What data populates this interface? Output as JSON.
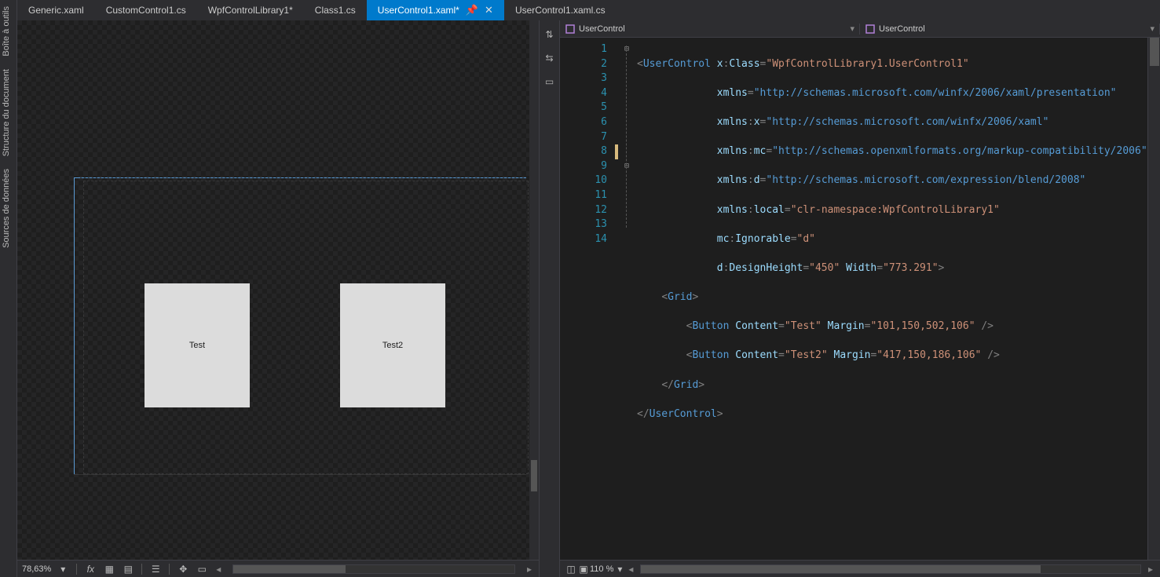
{
  "sidebars": {
    "toolbox": "Boîte à outils",
    "document_structure": "Structure du document",
    "data_sources": "Sources de données"
  },
  "tabs": [
    {
      "label": "Generic.xaml"
    },
    {
      "label": "CustomControl1.cs"
    },
    {
      "label": "WpfControlLibrary1*"
    },
    {
      "label": "Class1.cs"
    },
    {
      "label": "UserControl1.xaml*",
      "active": true,
      "closeable": true
    },
    {
      "label": "UserControl1.xaml.cs"
    }
  ],
  "designer": {
    "button1_text": "Test",
    "button2_text": "Test2",
    "zoom": "78,63%"
  },
  "code_nav": {
    "left": "UserControl",
    "right": "UserControl"
  },
  "editor": {
    "lines": [
      "1",
      "2",
      "3",
      "4",
      "5",
      "6",
      "7",
      "8",
      "9",
      "10",
      "11",
      "12",
      "13",
      "14"
    ],
    "zoom": "110 %"
  },
  "xaml": {
    "userControlOpen": "UserControl",
    "xClass_attr": "x",
    "xClass_name": "Class",
    "xClass_val": "WpfControlLibrary1.UserControl1",
    "xmlns": "xmlns",
    "xmlns_val": "http://schemas.microsoft.com/winfx/2006/xaml/presentation",
    "xmlns_x_name": "x",
    "xmlns_x_val": "http://schemas.microsoft.com/winfx/2006/xaml",
    "xmlns_mc_name": "mc",
    "xmlns_mc_val": "http://schemas.openxmlformats.org/markup-compatibility/2006",
    "xmlns_d_name": "d",
    "xmlns_d_val": "http://schemas.microsoft.com/expression/blend/2008",
    "xmlns_local_name": "local",
    "xmlns_local_val": "clr-namespace:WpfControlLibrary1",
    "mc": "mc",
    "ignorable": "Ignorable",
    "ignorable_val": "d",
    "d": "d",
    "designHeight": "DesignHeight",
    "designHeight_val": "450",
    "width": "Width",
    "width_val": "773.291",
    "grid": "Grid",
    "button": "Button",
    "content": "Content",
    "margin": "Margin",
    "b1_content": "Test",
    "b1_margin": "101,150,502,106",
    "b2_content": "Test2",
    "b2_margin": "417,150,186,106",
    "userControlClose": "UserControl"
  }
}
